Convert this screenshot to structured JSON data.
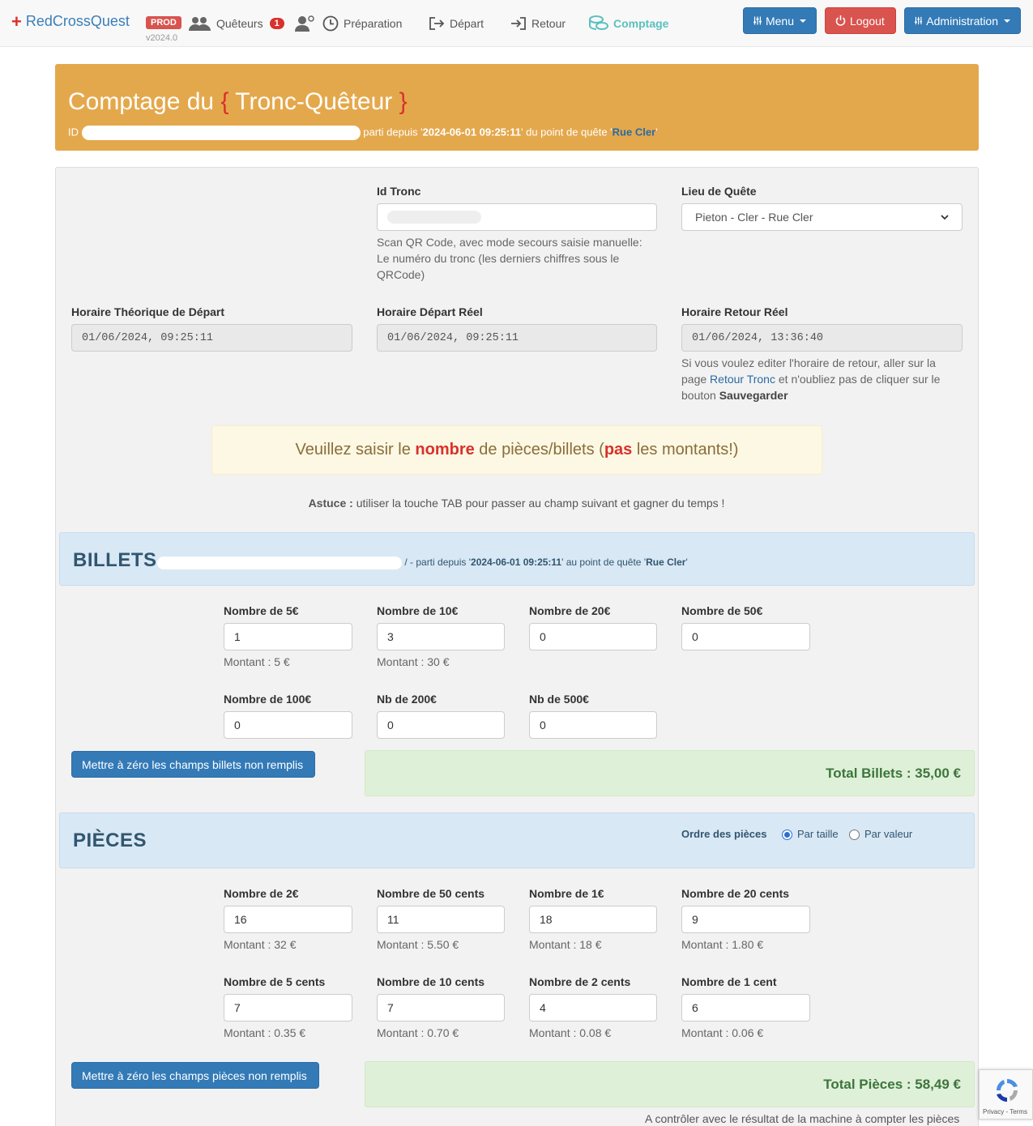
{
  "navbar": {
    "brand": "RedCrossQuest",
    "env_badge": "PROD",
    "version": "v2024.0",
    "links": {
      "queteurs": "Quêteurs",
      "queteurs_count": "1",
      "preparation": "Préparation",
      "depart": "Départ",
      "retour": "Retour",
      "comptage": "Comptage"
    },
    "menu_label": "Menu",
    "logout_label": "Logout",
    "admin_label": "Administration"
  },
  "header": {
    "title_prefix": "Comptage du",
    "brace_open": "{",
    "title_entity": "Tronc-Quêteur",
    "brace_close": "}",
    "id_label": "ID",
    "departed_since": "parti depuis '",
    "depart_datetime": "2024-06-01 09:25:11",
    "point_text": "' du point de quête '",
    "point_name": "Rue Cler",
    "point_end": "'"
  },
  "form": {
    "id_tronc_label": "Id Tronc",
    "id_tronc_help": "Scan QR Code, avec mode secours saisie manuelle: Le numéro du tronc (les derniers chiffres sous le QRCode)",
    "lieu_label": "Lieu de Quête",
    "lieu_value": "Pieton - Cler - Rue Cler",
    "horaire_theorique_label": "Horaire Théorique de Départ",
    "horaire_theorique_value": "01/06/2024, 09:25:11",
    "horaire_depart_label": "Horaire Départ Réel",
    "horaire_depart_value": "01/06/2024, 09:25:11",
    "horaire_retour_label": "Horaire Retour Réel",
    "horaire_retour_value": "01/06/2024, 13:36:40",
    "retour_help_1": "Si vous voulez editer l'horaire de retour, aller sur la page",
    "retour_help_link": "Retour Tronc",
    "retour_help_2": "et n'oubliez pas de cliquer sur le bouton",
    "retour_help_bold": "Sauvegarder"
  },
  "warning": {
    "part1": "Veuillez saisir le",
    "nombre": "nombre",
    "part2": "de pièces/billets (",
    "pas": "pas",
    "part3": "les montants!)"
  },
  "tip": {
    "label": "Astuce :",
    "text": "utiliser la touche TAB pour passer au champ suivant et gagner du temps !"
  },
  "billets": {
    "title": "BILLETS",
    "meta_sep": "/ - parti depuis '",
    "meta_date": "2024-06-01 09:25:11",
    "meta_point_text": "' au point de quête '",
    "meta_point": "Rue Cler",
    "meta_end": "'",
    "fields": [
      {
        "label": "Nombre de 5€",
        "value": "1",
        "montant": "Montant : 5 €"
      },
      {
        "label": "Nombre de 10€",
        "value": "3",
        "montant": "Montant : 30 €"
      },
      {
        "label": "Nombre de 20€",
        "value": "0",
        "montant": ""
      },
      {
        "label": "Nombre de 50€",
        "value": "0",
        "montant": ""
      },
      {
        "label": "Nombre de 100€",
        "value": "0",
        "montant": ""
      },
      {
        "label": "Nb de 200€",
        "value": "0",
        "montant": ""
      },
      {
        "label": "Nb de 500€",
        "value": "0",
        "montant": ""
      }
    ],
    "reset_label": "Mettre à zéro les champs billets non remplis",
    "total_label": "Total Billets : 35,00 €"
  },
  "pieces": {
    "title": "PIÈCES",
    "order_label": "Ordre des pièces",
    "order_options": [
      "Par taille",
      "Par valeur"
    ],
    "order_selected": "Par taille",
    "fields": [
      {
        "label": "Nombre de 2€",
        "value": "16",
        "montant": "Montant : 32 €"
      },
      {
        "label": "Nombre de 50 cents",
        "value": "11",
        "montant": "Montant : 5.50 €"
      },
      {
        "label": "Nombre de 1€",
        "value": "18",
        "montant": "Montant : 18 €"
      },
      {
        "label": "Nombre de 20 cents",
        "value": "9",
        "montant": "Montant : 1.80 €"
      },
      {
        "label": "Nombre de 5 cents",
        "value": "7",
        "montant": "Montant : 0.35 €"
      },
      {
        "label": "Nombre de 10 cents",
        "value": "7",
        "montant": "Montant : 0.70 €"
      },
      {
        "label": "Nombre de 2 cents",
        "value": "4",
        "montant": "Montant : 0.08 €"
      },
      {
        "label": "Nombre de 1 cent",
        "value": "6",
        "montant": "Montant : 0.06 €"
      }
    ],
    "reset_label": "Mettre à zéro les champs pièces non remplis",
    "total_label": "Total Pièces : 58,49 €",
    "footnote": "A contrôler avec le résultat de la machine à compter les pièces"
  },
  "recaptcha": {
    "text": "Privacy - Terms"
  },
  "colors": {
    "brand": "#3a7fb8",
    "header_bg": "#e4a84c",
    "primary": "#337ab7",
    "danger": "#d9534f",
    "success_text": "#3c763d"
  }
}
